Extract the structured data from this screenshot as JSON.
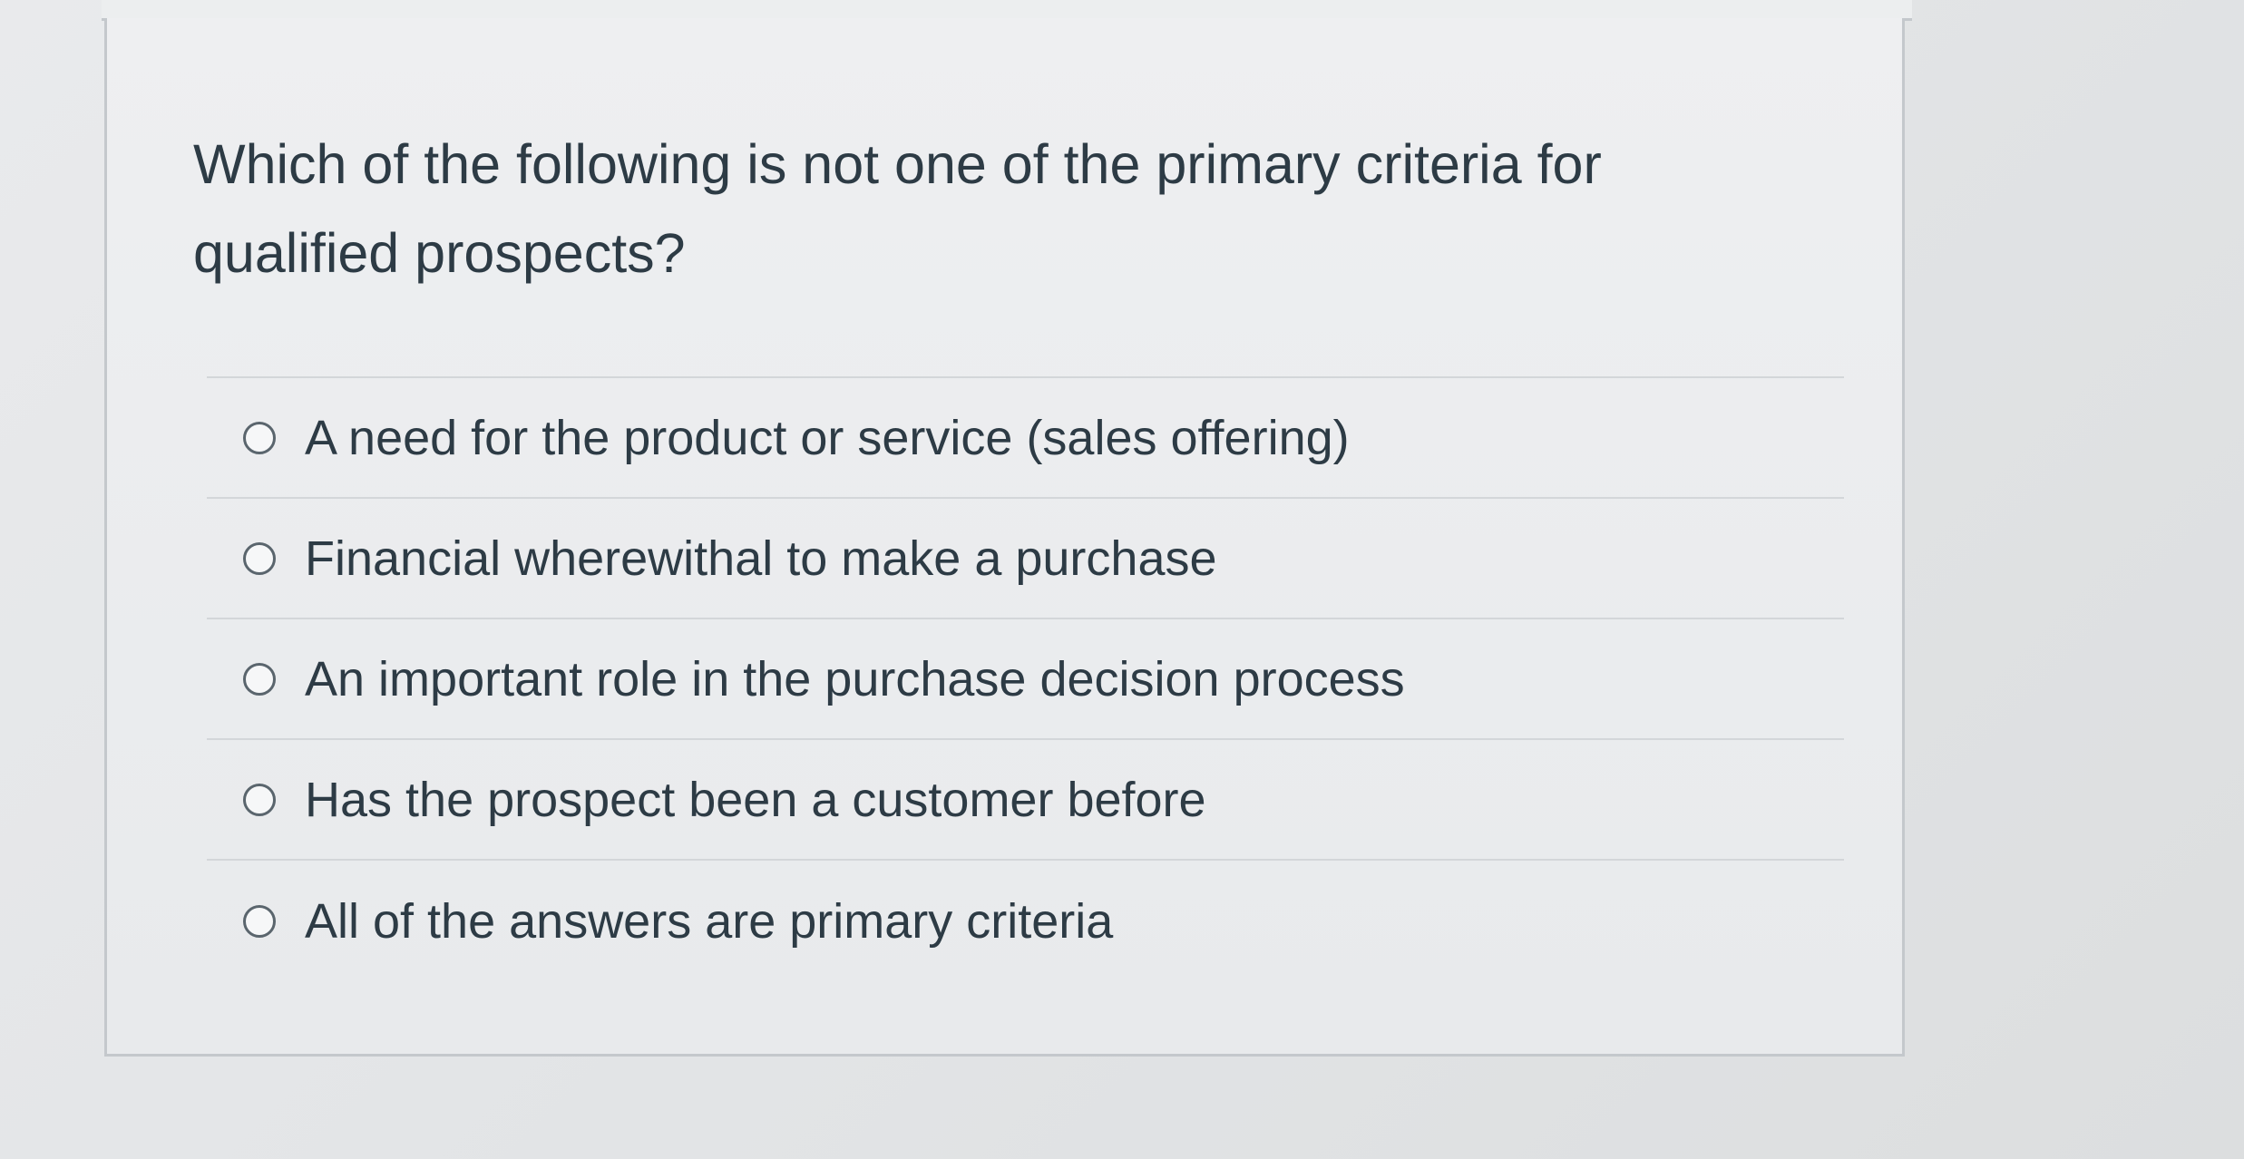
{
  "question": {
    "text": "Which of the following is not one of the primary criteria for qualified prospects?"
  },
  "answers": [
    {
      "label": "A need for the product or service (sales offering)"
    },
    {
      "label": "Financial wherewithal to make a purchase"
    },
    {
      "label": "An important role in the purchase decision process"
    },
    {
      "label": "Has the prospect been a customer before"
    },
    {
      "label": "All of the answers are primary criteria"
    }
  ],
  "colors": {
    "text": "#2d3b45",
    "border": "#c4c8cc",
    "radio_border": "#5a656d",
    "background": "#e6e8ea"
  }
}
